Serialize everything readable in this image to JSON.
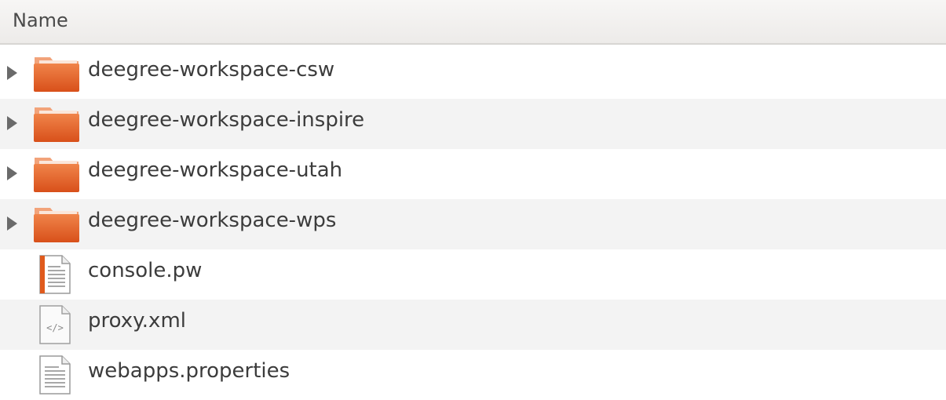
{
  "header": {
    "name_column": "Name"
  },
  "files": [
    {
      "name": "deegree-workspace-csw",
      "type": "folder",
      "icon": "folder-icon"
    },
    {
      "name": "deegree-workspace-inspire",
      "type": "folder",
      "icon": "folder-icon"
    },
    {
      "name": "deegree-workspace-utah",
      "type": "folder",
      "icon": "folder-icon"
    },
    {
      "name": "deegree-workspace-wps",
      "type": "folder",
      "icon": "folder-icon"
    },
    {
      "name": "console.pw",
      "type": "file",
      "icon": "text-document-icon"
    },
    {
      "name": "proxy.xml",
      "type": "file",
      "icon": "xml-file-icon"
    },
    {
      "name": "webapps.properties",
      "type": "file",
      "icon": "text-document-icon"
    }
  ],
  "colors": {
    "folder_orange": "#e05a1c",
    "folder_tab": "#f2a37a",
    "row_alt": "#f3f3f3"
  }
}
